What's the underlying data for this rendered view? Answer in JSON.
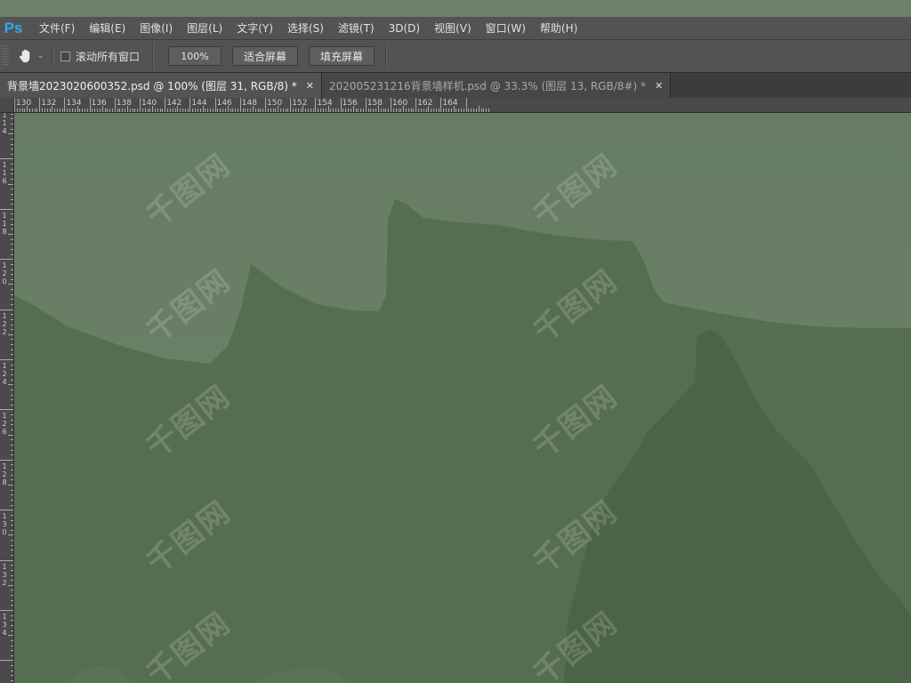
{
  "app": {
    "logo": "Ps"
  },
  "menu": [
    "文件(F)",
    "编辑(E)",
    "图像(I)",
    "图层(L)",
    "文字(Y)",
    "选择(S)",
    "滤镜(T)",
    "3D(D)",
    "视图(V)",
    "窗口(W)",
    "帮助(H)"
  ],
  "options": {
    "tool_icon": "hand-icon",
    "scroll_all_label": "滚动所有窗口",
    "scroll_all_checked": false,
    "zoom_value": "100%",
    "fit_screen_label": "适合屏幕",
    "fill_screen_label": "填充屏幕"
  },
  "tabs": [
    {
      "title": "背景墙20230206003​52.psd @ 100% (图层 31, RGB/8) *",
      "active": true
    },
    {
      "title": "202005231216背景墙样机.psd @ 33.3% (图层 13, RGB/8#) *",
      "active": false
    }
  ],
  "ruler": {
    "horizontal": [
      "130",
      "132",
      "134",
      "136",
      "138",
      "140",
      "142",
      "144",
      "146",
      "148",
      "150",
      "152",
      "154",
      "156",
      "158",
      "160",
      "162",
      "164"
    ],
    "vertical": [
      "114",
      "116",
      "118",
      "120",
      "122",
      "124",
      "126",
      "128",
      "130",
      "132",
      "134"
    ]
  },
  "watermark_text": "千图网",
  "colors": {
    "sky": "#6b8268",
    "mountain_mid": "#566e50",
    "mountain_dark": "#4a6245",
    "menu_bg": "#535353",
    "accent": "#31a8ff"
  }
}
